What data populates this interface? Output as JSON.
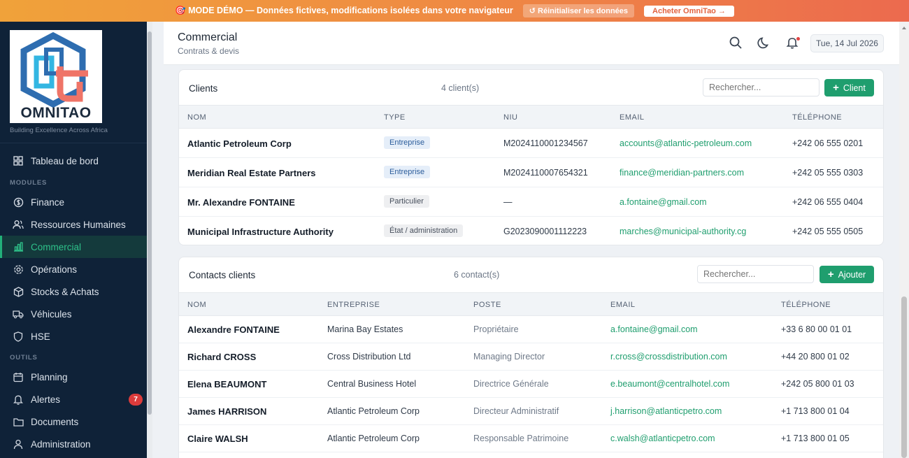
{
  "banner": {
    "text": "🎯 MODE DÉMO — Données fictives, modifications isolées dans votre navigateur",
    "reset_label": "↺ Réinitialiser les données",
    "buy_label": "Acheter OmniTao →"
  },
  "brand": {
    "logo_text": "OMNITAO",
    "tagline": "Building Excellence Across Africa",
    "colors": {
      "blue": "#2e6db0",
      "cyan": "#33b6e2",
      "coral": "#ef7467"
    }
  },
  "sidebar": {
    "dashboard": "Tableau de bord",
    "modules_label": "MODULES",
    "modules": [
      "Finance",
      "Ressources Humaines",
      "Commercial",
      "Opérations",
      "Stocks & Achats",
      "Véhicules",
      "HSE"
    ],
    "active_module": "Commercial",
    "tools_label": "OUTILS",
    "tools": [
      "Planning",
      "Alertes",
      "Documents",
      "Administration"
    ],
    "alerts_count": "7"
  },
  "header": {
    "title": "Commercial",
    "subtitle": "Contrats & devis",
    "date": "Tue, 14 Jul 2026",
    "icons": [
      "search-icon",
      "moon-icon",
      "bell-icon"
    ]
  },
  "clients": {
    "title": "Clients",
    "count": "4 client(s)",
    "search_placeholder": "Rechercher...",
    "add_label": "Client",
    "columns": [
      "NOM",
      "TYPE",
      "NIU",
      "EMAIL",
      "TÉLÉPHONE"
    ],
    "rows": [
      {
        "nom": "Atlantic Petroleum Corp",
        "type": "Entreprise",
        "niu": "M2024110001234567",
        "email": "accounts@atlantic-petroleum.com",
        "tel": "+242 06 555 0201"
      },
      {
        "nom": "Meridian Real Estate Partners",
        "type": "Entreprise",
        "niu": "M2024110007654321",
        "email": "finance@meridian-partners.com",
        "tel": "+242 05 555 0303"
      },
      {
        "nom": "Mr. Alexandre FONTAINE",
        "type": "Particulier",
        "niu": "—",
        "email": "a.fontaine@gmail.com",
        "tel": "+242 06 555 0404"
      },
      {
        "nom": "Municipal Infrastructure Authority",
        "type": "État / administration",
        "niu": "G2023090001112223",
        "email": "marches@municipal-authority.cg",
        "tel": "+242 05 555 0505"
      }
    ]
  },
  "contacts": {
    "title": "Contacts clients",
    "count": "6 contact(s)",
    "search_placeholder": "Rechercher...",
    "add_label": "Ajouter",
    "columns": [
      "NOM",
      "ENTREPRISE",
      "POSTE",
      "EMAIL",
      "TÉLÉPHONE"
    ],
    "rows": [
      {
        "nom": "Alexandre FONTAINE",
        "entreprise": "Marina Bay Estates",
        "poste": "Propriétaire",
        "email": "a.fontaine@gmail.com",
        "tel": "+33 6 80 00 01 01"
      },
      {
        "nom": "Richard CROSS",
        "entreprise": "Cross Distribution Ltd",
        "poste": "Managing Director",
        "email": "r.cross@crossdistribution.com",
        "tel": "+44 20 800 01 02"
      },
      {
        "nom": "Elena BEAUMONT",
        "entreprise": "Central Business Hotel",
        "poste": "Directrice Générale",
        "email": "e.beaumont@centralhotel.com",
        "tel": "+242 05 800 01 03"
      },
      {
        "nom": "James HARRISON",
        "entreprise": "Atlantic Petroleum Corp",
        "poste": "Directeur Administratif",
        "email": "j.harrison@atlanticpetro.com",
        "tel": "+1 713 800 01 04"
      },
      {
        "nom": "Claire WALSH",
        "entreprise": "Atlantic Petroleum Corp",
        "poste": "Responsable Patrimoine",
        "email": "c.walsh@atlanticpetro.com",
        "tel": "+1 713 800 01 05"
      }
    ]
  }
}
